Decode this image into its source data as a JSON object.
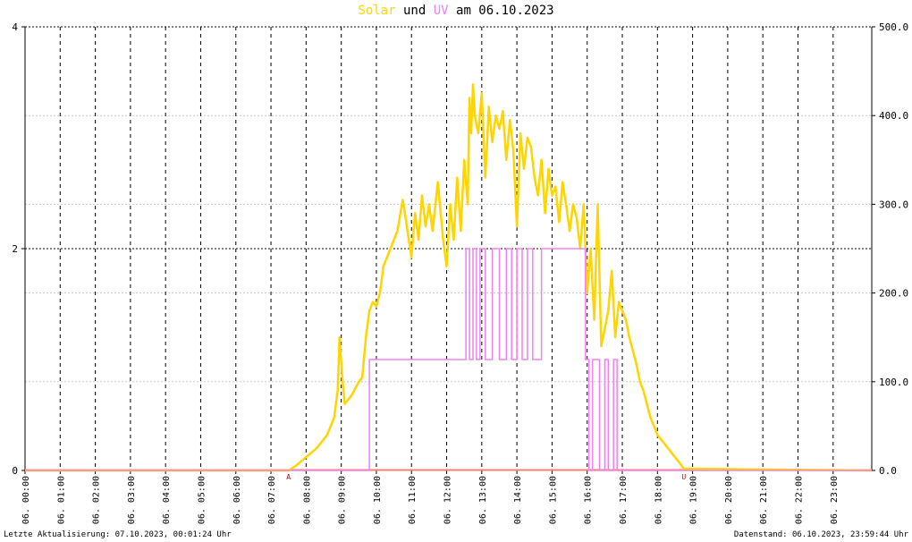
{
  "header": {
    "title_part1": "Solar",
    "title_part2": "und",
    "title_part3": "UV",
    "title_part4": "am 06.10.2023"
  },
  "footer": {
    "left": "Letzte Aktualisierung: 07.10.2023, 00:01:24 Uhr",
    "right": "Datenstand: 06.10.2023, 23:59:44 Uhr"
  },
  "colors": {
    "solar": "#FFD500",
    "uv": "#EE82EE",
    "baseline": "#F08070",
    "markers": "#CC0000",
    "grid": "#000000"
  },
  "chart_data": {
    "type": "line",
    "title": "Solar und UV am 06.10.2023",
    "x_unit": "hour of day",
    "x_range": [
      0,
      24.1
    ],
    "x_tick_labels": [
      "06. 00:00",
      "06. 01:00",
      "06. 02:00",
      "06. 03:00",
      "06. 04:00",
      "06. 05:00",
      "06. 06:00",
      "06. 07:00",
      "06. 08:00",
      "06. 09:00",
      "06. 10:00",
      "06. 11:00",
      "06. 12:00",
      "06. 13:00",
      "06. 14:00",
      "06. 15:00",
      "06. 16:00",
      "06. 17:00",
      "06. 18:00",
      "06. 19:00",
      "06. 20:00",
      "06. 21:00",
      "06. 22:00",
      "06. 23:00"
    ],
    "y_left": {
      "range": [
        0,
        4
      ],
      "ticks": [
        0,
        2,
        4
      ],
      "tick_labels": [
        "0",
        "2",
        "4"
      ]
    },
    "y_right": {
      "range": [
        0,
        500
      ],
      "ticks": [
        0,
        100,
        200,
        300,
        400,
        500
      ],
      "tick_labels": [
        "0.0",
        "100.0",
        "200.0",
        "300.0",
        "400.0",
        "500.0"
      ]
    },
    "markers": [
      {
        "label": "A",
        "x": 7.5
      },
      {
        "label": "U",
        "x": 18.75
      }
    ],
    "series": [
      {
        "name": "Solar",
        "axis": "right",
        "x": [
          0,
          7.5,
          7.7,
          8.0,
          8.3,
          8.6,
          8.8,
          8.9,
          8.95,
          9.0,
          9.05,
          9.1,
          9.3,
          9.5,
          9.6,
          9.7,
          9.8,
          9.9,
          10.0,
          10.1,
          10.2,
          10.4,
          10.6,
          10.75,
          10.85,
          11.0,
          11.1,
          11.2,
          11.3,
          11.4,
          11.5,
          11.6,
          11.75,
          11.9,
          12.0,
          12.1,
          12.2,
          12.3,
          12.4,
          12.5,
          12.6,
          12.65,
          12.7,
          12.75,
          12.8,
          12.9,
          13.0,
          13.1,
          13.2,
          13.3,
          13.4,
          13.5,
          13.6,
          13.7,
          13.8,
          13.9,
          14.0,
          14.1,
          14.2,
          14.3,
          14.4,
          14.5,
          14.6,
          14.7,
          14.8,
          14.9,
          15.0,
          15.1,
          15.2,
          15.3,
          15.4,
          15.5,
          15.6,
          15.7,
          15.8,
          15.9,
          16.0,
          16.1,
          16.2,
          16.3,
          16.4,
          16.5,
          16.6,
          16.7,
          16.8,
          16.9,
          17.0,
          17.1,
          17.2,
          17.3,
          17.4,
          17.5,
          17.6,
          17.8,
          18.0,
          18.2,
          18.4,
          18.6,
          18.75,
          24.1
        ],
        "y": [
          0,
          0,
          5,
          15,
          25,
          40,
          60,
          90,
          150,
          120,
          95,
          75,
          85,
          100,
          105,
          150,
          180,
          190,
          185,
          200,
          230,
          250,
          270,
          305,
          280,
          240,
          290,
          260,
          310,
          275,
          300,
          270,
          325,
          260,
          230,
          300,
          260,
          330,
          270,
          350,
          300,
          420,
          380,
          435,
          400,
          380,
          425,
          330,
          410,
          370,
          400,
          385,
          405,
          350,
          395,
          360,
          275,
          380,
          340,
          375,
          365,
          330,
          310,
          350,
          290,
          340,
          310,
          320,
          280,
          325,
          300,
          270,
          300,
          285,
          250,
          300,
          200,
          250,
          170,
          300,
          140,
          160,
          180,
          225,
          150,
          190,
          180,
          170,
          150,
          135,
          120,
          100,
          90,
          60,
          40,
          30,
          20,
          10,
          2,
          0
        ]
      },
      {
        "name": "UV",
        "axis": "left",
        "x": [
          0,
          9.8,
          9.8,
          12.55,
          12.55,
          12.65,
          12.65,
          12.75,
          12.75,
          12.85,
          12.85,
          12.95,
          12.95,
          13.1,
          13.1,
          13.3,
          13.3,
          13.5,
          13.5,
          13.7,
          13.7,
          13.85,
          13.85,
          14.0,
          14.0,
          14.15,
          14.15,
          14.3,
          14.3,
          14.45,
          14.45,
          14.7,
          14.7,
          15.95,
          15.95,
          16.05,
          16.05,
          16.15,
          16.15,
          16.35,
          16.35,
          16.5,
          16.5,
          16.6,
          16.6,
          16.75,
          16.75,
          16.85,
          16.85,
          24.1
        ],
        "y": [
          0,
          0,
          1,
          1,
          2,
          2,
          1,
          1,
          2,
          2,
          1,
          1,
          2,
          2,
          1,
          1,
          2,
          2,
          1,
          1,
          2,
          2,
          1,
          1,
          2,
          2,
          1,
          1,
          2,
          2,
          1,
          1,
          2,
          2,
          1,
          1,
          0,
          0,
          1,
          1,
          0,
          0,
          1,
          1,
          0,
          0,
          1,
          1,
          0,
          0
        ]
      }
    ]
  }
}
